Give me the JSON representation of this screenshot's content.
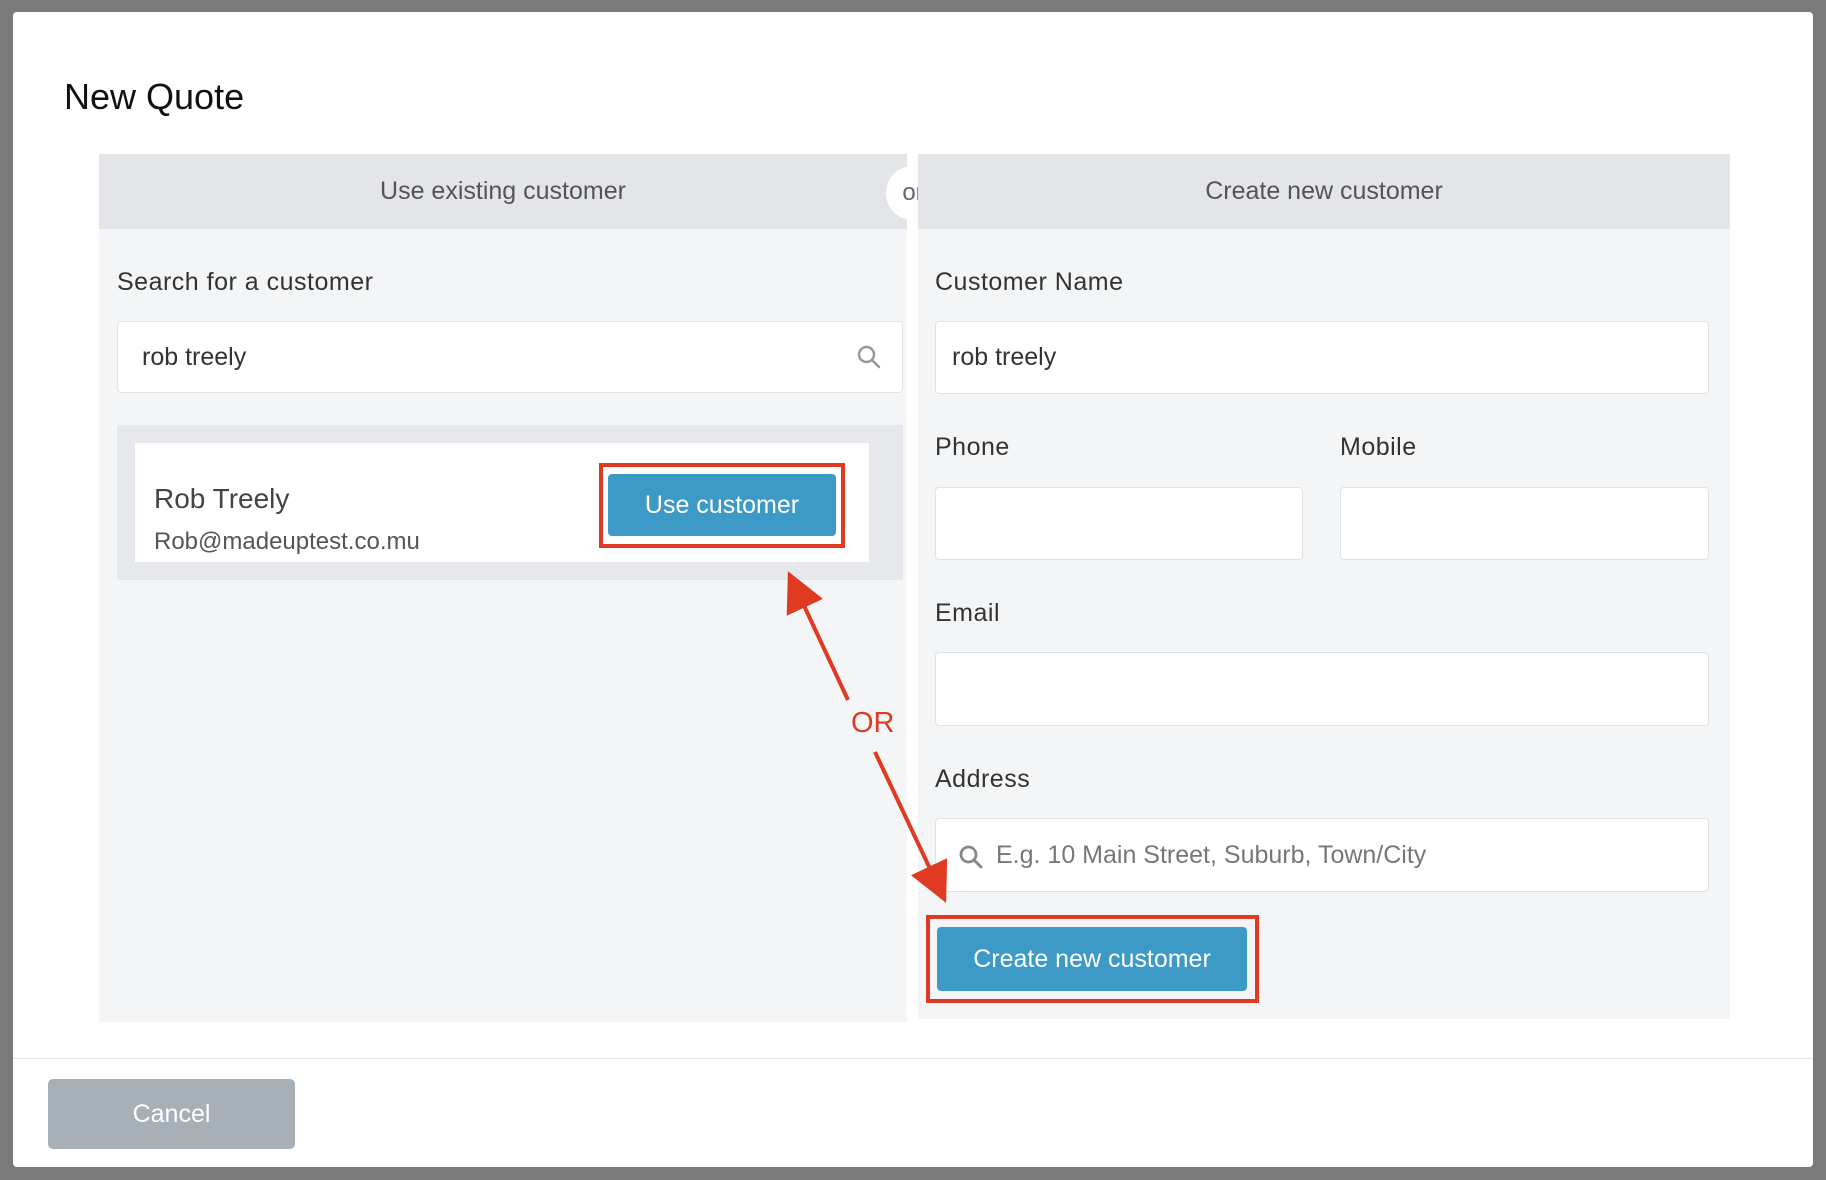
{
  "modal": {
    "title": "New Quote"
  },
  "or_divider": "or",
  "existing": {
    "header": "Use existing customer",
    "search_label": "Search for a customer",
    "search_value": "rob treely",
    "results": [
      {
        "name": "Rob Treely",
        "email": "Rob@madeuptest.co.mu",
        "button": "Use customer"
      }
    ]
  },
  "create": {
    "header": "Create new customer",
    "name_label": "Customer Name",
    "name_value": "rob treely",
    "phone_label": "Phone",
    "phone_value": "",
    "mobile_label": "Mobile",
    "mobile_value": "",
    "email_label": "Email",
    "email_value": "",
    "address_label": "Address",
    "address_placeholder": "E.g. 10 Main Street, Suburb, Town/City",
    "submit": "Create new customer"
  },
  "annotation": {
    "or_text": "OR",
    "color": "#e03a22"
  },
  "footer": {
    "cancel": "Cancel"
  },
  "colors": {
    "primary": "#3d9ac6",
    "cancel": "#a8b0b7",
    "panel": "#f3f5f7",
    "header": "#e3e5e8"
  }
}
